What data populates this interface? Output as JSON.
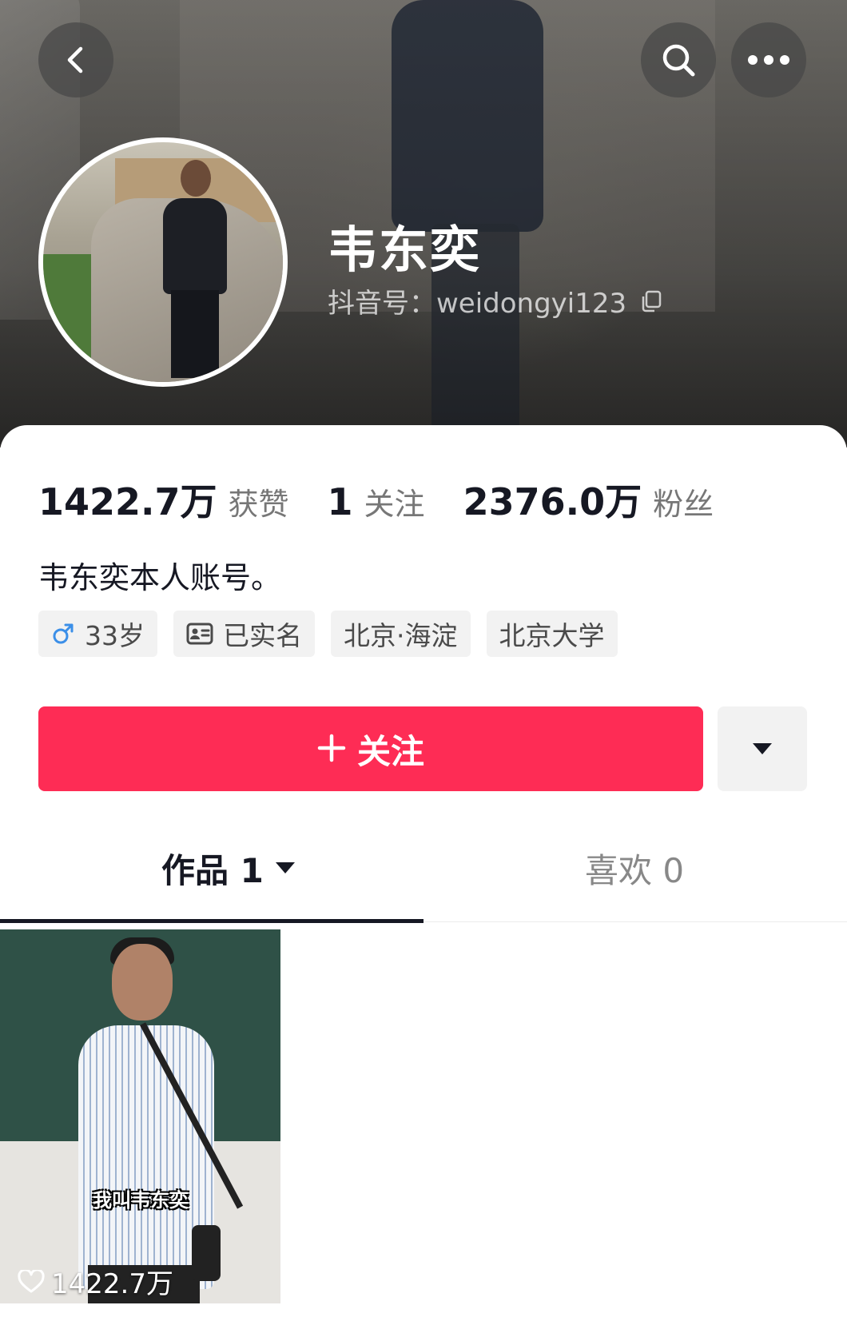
{
  "profile": {
    "name": "韦东奕",
    "id_label": "抖音号：weidongyi123",
    "bio": "韦东奕本人账号。"
  },
  "stats": {
    "likes": {
      "value": "1422.7万",
      "label": "获赞"
    },
    "following": {
      "value": "1",
      "label": "关注"
    },
    "followers": {
      "value": "2376.0万",
      "label": "粉丝"
    }
  },
  "tags": [
    {
      "icon": "male-icon",
      "label": "33岁"
    },
    {
      "icon": "id-card-icon",
      "label": "已实名"
    },
    {
      "label": "北京·海淀"
    },
    {
      "label": "北京大学"
    }
  ],
  "actions": {
    "follow_label": "关注",
    "follow_icon": "plus-icon",
    "more_icon": "caret-down-icon"
  },
  "tabs": [
    {
      "label": "作品 1",
      "active": true
    },
    {
      "label": "喜欢 0",
      "active": false
    }
  ],
  "videos": [
    {
      "caption": "我叫韦东奕",
      "likes": "1422.7万"
    }
  ],
  "colors": {
    "accent": "#fe2c55",
    "text_primary": "#161823",
    "text_secondary": "#777777"
  }
}
